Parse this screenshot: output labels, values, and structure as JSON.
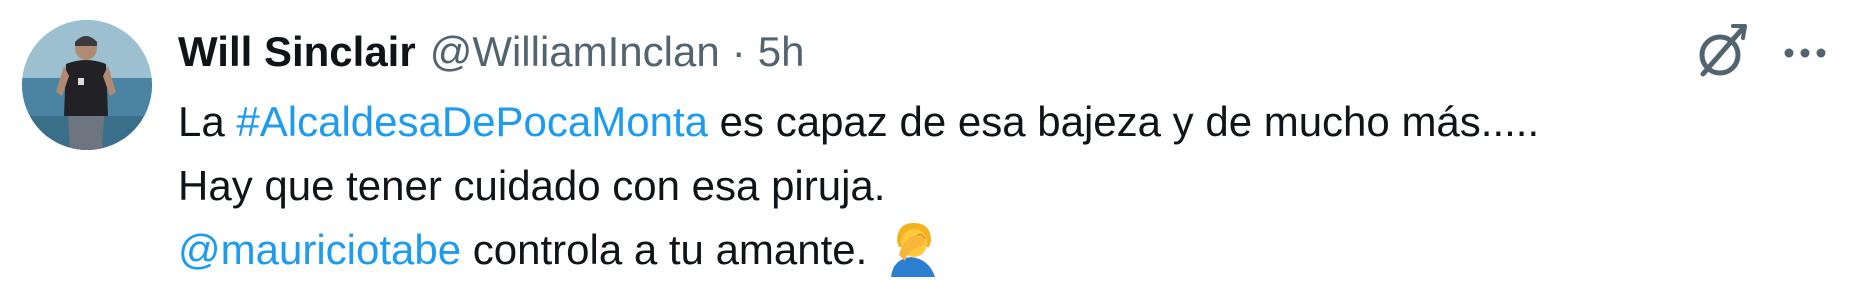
{
  "tweet": {
    "author": {
      "display_name": "Will Sinclair",
      "handle": "@WilliamInclan",
      "avatar": "profile-photo-man-by-sea"
    },
    "separator": "·",
    "timestamp": "5h",
    "body": {
      "line1_prefix": "La ",
      "hashtag": "#AlcaldesaDePocaMonta",
      "line1_suffix": " es capaz de esa bajeza y de mucho más.....",
      "line2": "Hay que tener cuidado con esa piruja.",
      "mention": "@mauriciotabe",
      "line3_suffix": " controla a tu amante.",
      "emoji": "person-facepalming-emoji"
    },
    "actions": {
      "grok_icon": "grok-icon",
      "more_icon": "more-horizontal-icon"
    }
  },
  "colors": {
    "text": "#0f1419",
    "secondary": "#536471",
    "link": "#1d9bf0",
    "background": "#ffffff"
  }
}
